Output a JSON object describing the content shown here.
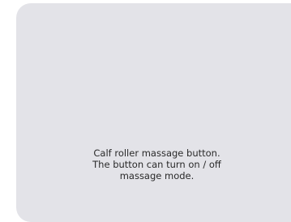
{
  "tooltip": {
    "lines": [
      "Calf roller massage button.",
      "The button can turn on / off",
      "massage mode."
    ]
  }
}
